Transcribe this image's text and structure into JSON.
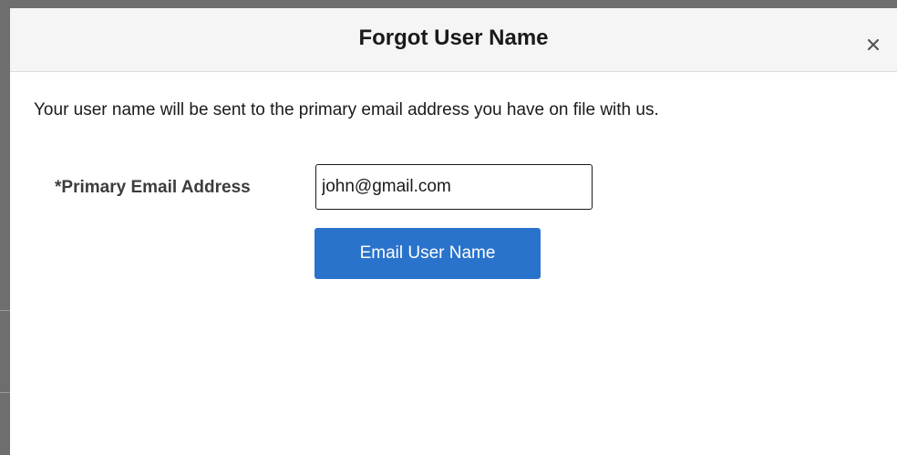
{
  "dialog": {
    "title": "Forgot User Name",
    "close_icon": "close-icon"
  },
  "body": {
    "instruction": "Your user name will be sent to the primary email address you have on file with us.",
    "email_label": "*Primary Email Address",
    "email_value": "john@gmail.com",
    "submit_label": "Email User Name"
  },
  "colors": {
    "button_bg": "#2a73cc",
    "header_bg": "#f5f5f5",
    "backdrop": "#6e6e6e"
  }
}
